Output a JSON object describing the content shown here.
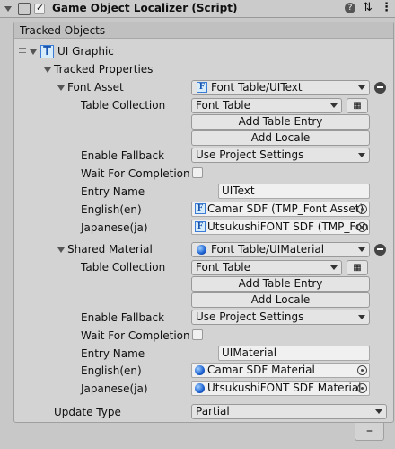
{
  "header": {
    "title": "Game Object Localizer (Script)",
    "help_glyph": "?",
    "settings_glyph": "⇅",
    "menu_glyph": "⋮"
  },
  "tracked_objects": {
    "heading": "Tracked Objects",
    "item_label": "UI Graphic",
    "item_icon_letter": "T"
  },
  "tracked_properties": {
    "label": "Tracked Properties",
    "font_asset": {
      "label": "Font Asset",
      "value": "Font Table/UIText",
      "icon_letter": "F",
      "table_collection_label": "Table Collection",
      "table_collection_value": "Font Table",
      "add_table_entry": "Add Table Entry",
      "add_locale": "Add Locale",
      "enable_fallback_label": "Enable Fallback",
      "enable_fallback_value": "Use Project Settings",
      "wait_label": "Wait For Completion",
      "entry_name_label": "Entry Name",
      "entry_name_value": "UIText",
      "english_label": "English(en)",
      "english_value": "Camar SDF (TMP_Font Asset)",
      "japanese_label": "Japanese(ja)",
      "japanese_value": "UtsukushiFONT SDF (TMP_Font Asset)"
    },
    "shared_material": {
      "label": "Shared Material",
      "value": "Font Table/UIMaterial",
      "table_collection_label": "Table Collection",
      "table_collection_value": "Font Table",
      "add_table_entry": "Add Table Entry",
      "add_locale": "Add Locale",
      "enable_fallback_label": "Enable Fallback",
      "enable_fallback_value": "Use Project Settings",
      "wait_label": "Wait For Completion",
      "entry_name_label": "Entry Name",
      "entry_name_value": "UIMaterial",
      "english_label": "English(en)",
      "english_value": "Camar SDF Material",
      "japanese_label": "Japanese(ja)",
      "japanese_value": "UtsukushiFONT SDF Material"
    }
  },
  "update_type": {
    "label": "Update Type",
    "value": "Partial"
  },
  "footer": {
    "remove_glyph": "–"
  }
}
